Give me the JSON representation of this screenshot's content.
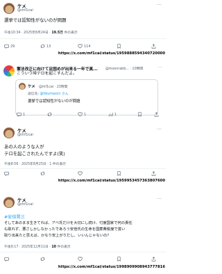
{
  "post1": {
    "name": "ケメ",
    "handle": "@mf1cai",
    "more": "···",
    "text": "選挙では認知性がないのが問題",
    "time": "午後10:34 · 2025年8月24日 · ",
    "views_count": "19.5万",
    "views_label": " 件の表示",
    "actions": {
      "reply": "29",
      "repost": "13",
      "like": "114",
      "bookmark": ""
    },
    "url": "https://x.com/mf1cai/status/1959888594340720000"
  },
  "post2": {
    "name": "憲法改正に向けて足固めが出来る一年で真...",
    "handle": "@moonrabb... · 10時間",
    "more": "···",
    "text": "こういう時テロを起こすんだよ。",
    "quote": {
      "name": "ケメ",
      "handle": "@mf1cai · 23時間",
      "reply_to_prefix": "返信先: ",
      "reply_to": "@tikumaocn さん",
      "text": "選挙では認知性がないのが問題"
    },
    "actions": {
      "reply": "1",
      "repost": "",
      "like": "1",
      "views": "1",
      "bookmark": ""
    }
  },
  "post3": {
    "name": "ケメ",
    "handle": "@mf1cai",
    "more": "···",
    "text_lines": [
      "あの人のような人が",
      "テロを起こされたんですよ(笑)"
    ],
    "time": "午後8:56 · 2025年8月25日 · 1 件の表示",
    "actions": {
      "reply": "",
      "repost": "",
      "like": "",
      "bookmark": ""
    },
    "url": "https://x.com/mf1cai/status/1959953457363807600"
  },
  "post4": {
    "name": "ケメ",
    "handle": "@mf1cai",
    "more": "···",
    "hashtag": "#安倍晋三",
    "text_lines": [
      "そしてあのまま生きてれば、アベ氏だけを大切にし続け、付度国家で何の責任",
      "も取れず、悪さしかしなかったであろう安倍氏の生命を国葬費税度で賞い",
      "取り出来たと思えば、かなり安上がりだし、いいんじゃないの？"
    ],
    "time": "午後9:17 · 2025年12月11日 · ",
    "views_count": "10",
    "views_label": " 件の表示",
    "actions": {
      "reply": "",
      "repost": "",
      "like": "",
      "bookmark": ""
    },
    "url": "https://x.com/mf1cai/status/1998909908943777816"
  },
  "colors": {
    "link": "#1d9bf0",
    "muted": "#536471",
    "text": "#0f1419",
    "border": "#eff3f4"
  },
  "icons": [
    "reply-icon",
    "repost-icon",
    "like-icon",
    "bookmark-icon",
    "views-icon",
    "share-icon",
    "more-icon"
  ]
}
